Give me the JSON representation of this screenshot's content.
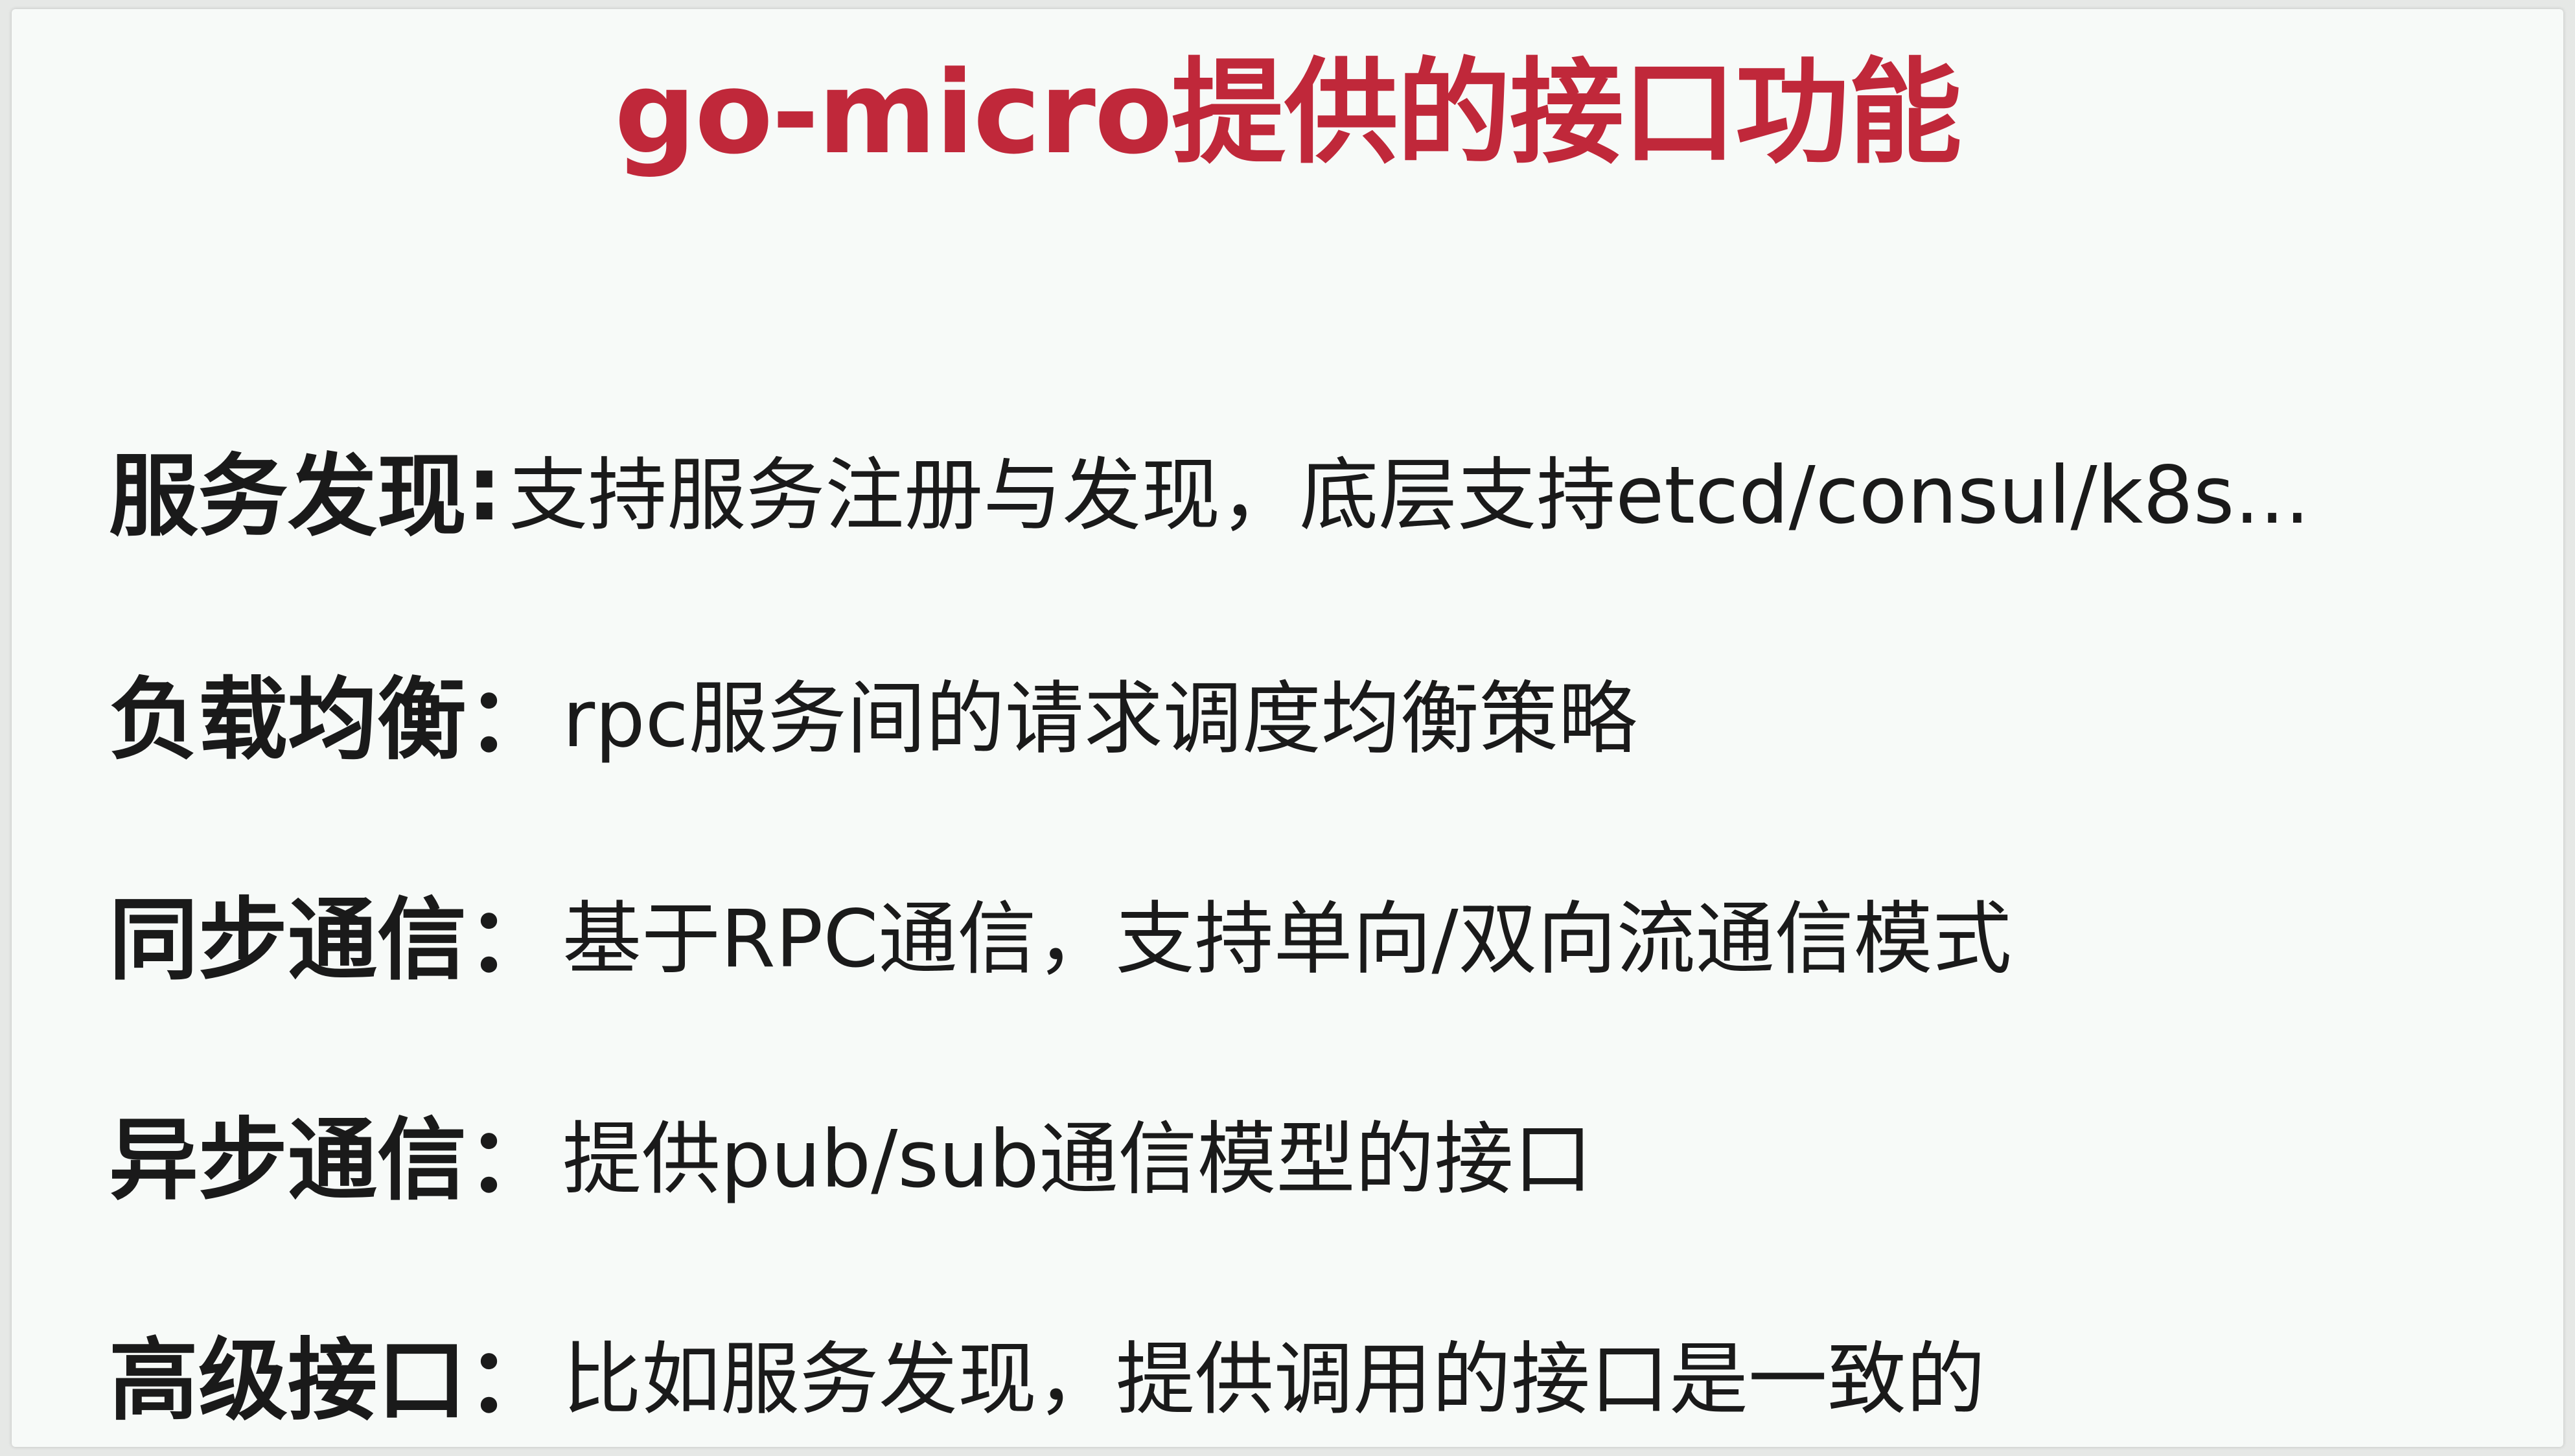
{
  "slide": {
    "title": "go-micro提供的接口功能",
    "title_color": "#c0283a",
    "items": [
      {
        "term": "服务发现",
        "sep": ":",
        "desc": "支持服务注册与发现，底层支持etcd/consul/k8s..."
      },
      {
        "term": "负载均衡",
        "sep": "：",
        "desc": "rpc服务间的请求调度均衡策略"
      },
      {
        "term": "同步通信",
        "sep": "：",
        "desc": "基于RPC通信，支持单向/双向流通信模式"
      },
      {
        "term": "异步通信",
        "sep": "：",
        "desc": "提供pub/sub通信模型的接口"
      },
      {
        "term": "高级接口",
        "sep": "：",
        "desc": "比如服务发现，提供调用的接口是一致的"
      }
    ]
  }
}
